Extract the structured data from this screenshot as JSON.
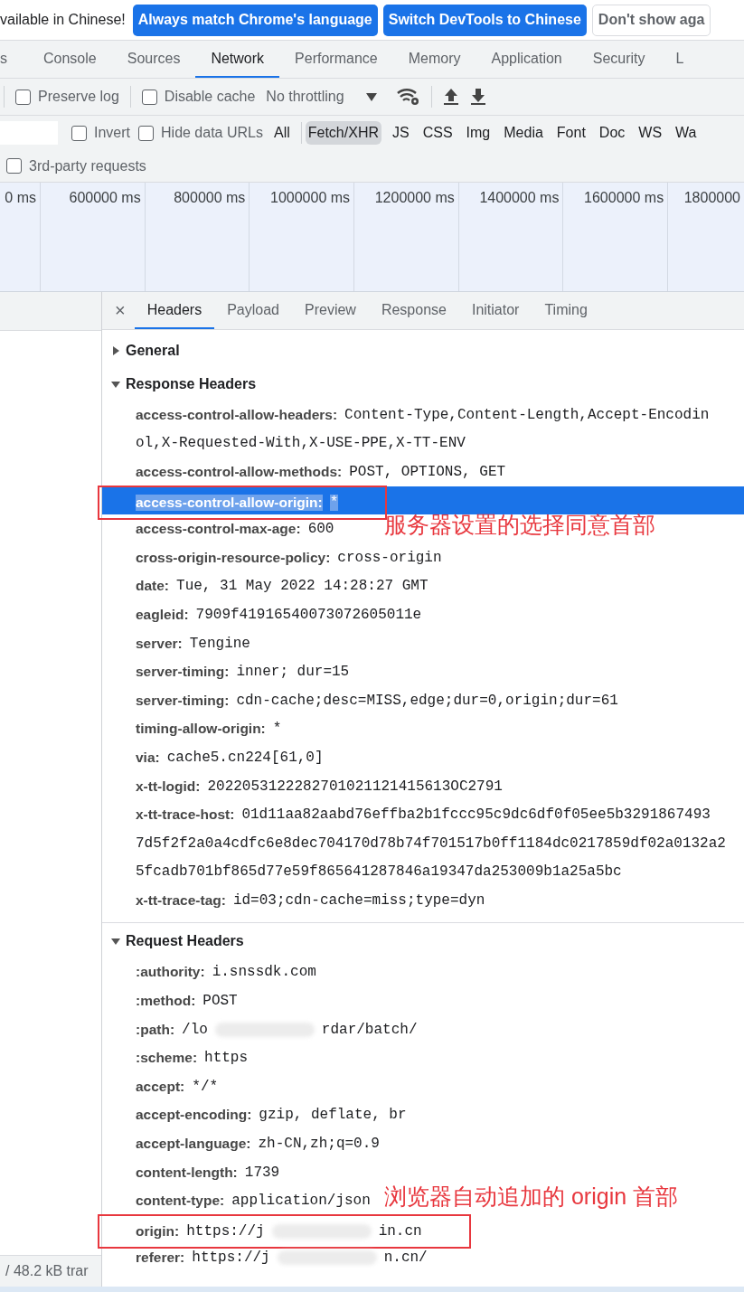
{
  "infobar": {
    "message": "vailable in Chinese!",
    "buttons": [
      {
        "label": "Always match Chrome's language",
        "kind": "primary"
      },
      {
        "label": "Switch DevTools to Chinese",
        "kind": "primary"
      },
      {
        "label": "Don't show aga",
        "kind": "secondary"
      }
    ]
  },
  "main_tabs": [
    {
      "label": "s",
      "selected": false
    },
    {
      "label": "Console",
      "selected": false
    },
    {
      "label": "Sources",
      "selected": false
    },
    {
      "label": "Network",
      "selected": true
    },
    {
      "label": "Performance",
      "selected": false
    },
    {
      "label": "Memory",
      "selected": false
    },
    {
      "label": "Application",
      "selected": false
    },
    {
      "label": "Security",
      "selected": false
    },
    {
      "label": "L",
      "selected": false
    }
  ],
  "toolbar": {
    "preserve_log": {
      "label": "Preserve log",
      "checked": false
    },
    "disable_cache": {
      "label": "Disable cache",
      "checked": false
    },
    "throttling": "No throttling"
  },
  "filter_bar": {
    "invert": {
      "label": "Invert",
      "checked": false
    },
    "hide_data_urls": {
      "label": "Hide data URLs",
      "checked": false
    },
    "types": [
      {
        "label": "All",
        "selected": false
      },
      {
        "label": "Fetch/XHR",
        "selected": true
      },
      {
        "label": "JS",
        "selected": false
      },
      {
        "label": "CSS",
        "selected": false
      },
      {
        "label": "Img",
        "selected": false
      },
      {
        "label": "Media",
        "selected": false
      },
      {
        "label": "Font",
        "selected": false
      },
      {
        "label": "Doc",
        "selected": false
      },
      {
        "label": "WS",
        "selected": false
      },
      {
        "label": "Wa",
        "selected": false
      }
    ]
  },
  "third_party": {
    "label": "3rd-party requests",
    "checked": false
  },
  "timeline_ticks": [
    "0 ms",
    "600000 ms",
    "800000 ms",
    "1000000 ms",
    "1200000 ms",
    "1400000 ms",
    "1600000 ms",
    "1800000"
  ],
  "request_list": {
    "status": "/ 48.2 kB trar"
  },
  "detail_tabs": {
    "close": "×",
    "tabs": [
      {
        "label": "Headers",
        "selected": true
      },
      {
        "label": "Payload",
        "selected": false
      },
      {
        "label": "Preview",
        "selected": false
      },
      {
        "label": "Response",
        "selected": false
      },
      {
        "label": "Initiator",
        "selected": false
      },
      {
        "label": "Timing",
        "selected": false
      }
    ]
  },
  "sections": [
    {
      "title": "General",
      "expanded": false
    },
    {
      "title": "Response Headers",
      "expanded": true,
      "headers": [
        {
          "name": "access-control-allow-headers:",
          "kind": "plain",
          "value_lines": [
            "Content-Type,Content-Length,Accept-Encodin",
            "ol,X-Requested-With,X-USE-PPE,X-TT-ENV"
          ],
          "selected": false,
          "boxed": false
        },
        {
          "name": "access-control-allow-methods:",
          "kind": "plain",
          "value_lines": [
            "POST, OPTIONS, GET"
          ],
          "selected": false,
          "boxed": false
        },
        {
          "name": "access-control-allow-origin:",
          "kind": "plain",
          "value_lines": [
            "*"
          ],
          "selected": true,
          "boxed": true
        },
        {
          "name": "access-control-max-age:",
          "kind": "plain",
          "value_lines": [
            "600"
          ],
          "selected": false,
          "boxed": false,
          "note": "服务器设置的选择同意首部"
        },
        {
          "name": "cross-origin-resource-policy:",
          "kind": "plain",
          "value_lines": [
            "cross-origin"
          ],
          "selected": false,
          "boxed": false
        },
        {
          "name": "date:",
          "kind": "plain",
          "value_lines": [
            "Tue, 31 May 2022 14:28:27 GMT"
          ],
          "selected": false,
          "boxed": false
        },
        {
          "name": "eagleid:",
          "kind": "plain",
          "value_lines": [
            "7909f41916540073072605011e"
          ],
          "selected": false,
          "boxed": false
        },
        {
          "name": "server:",
          "kind": "plain",
          "value_lines": [
            "Tengine"
          ],
          "selected": false,
          "boxed": false
        },
        {
          "name": "server-timing:",
          "kind": "plain",
          "value_lines": [
            "inner; dur=15"
          ],
          "selected": false,
          "boxed": false
        },
        {
          "name": "server-timing:",
          "kind": "plain",
          "value_lines": [
            "cdn-cache;desc=MISS,edge;dur=0,origin;dur=61"
          ],
          "selected": false,
          "boxed": false
        },
        {
          "name": "timing-allow-origin:",
          "kind": "plain",
          "value_lines": [
            "*"
          ],
          "selected": false,
          "boxed": false
        },
        {
          "name": "via:",
          "kind": "plain",
          "value_lines": [
            "cache5.cn224[61,0]"
          ],
          "selected": false,
          "boxed": false
        },
        {
          "name": "x-tt-logid:",
          "kind": "plain",
          "value_lines": [
            "2022053122282701021121415613OC2791"
          ],
          "selected": false,
          "boxed": false
        },
        {
          "name": "x-tt-trace-host:",
          "kind": "plain",
          "value_lines": [
            "01d11aa82aabd76effba2b1fccc95c9dc6df0f05ee5b3291867493",
            "7d5f2f2a0a4cdfc6e8dec704170d78b74f701517b0ff1184dc0217859df02a0132a2",
            "5fcadb701bf865d77e59f865641287846a19347da253009b1a25a5bc"
          ],
          "selected": false,
          "boxed": false
        },
        {
          "name": "x-tt-trace-tag:",
          "kind": "plain",
          "value_lines": [
            "id=03;cdn-cache=miss;type=dyn"
          ],
          "selected": false,
          "boxed": false
        }
      ]
    },
    {
      "title": "Request Headers",
      "expanded": true,
      "headers": [
        {
          "name": ":authority:",
          "kind": "plain",
          "value_lines": [
            "i.snssdk.com"
          ],
          "selected": false,
          "boxed": false
        },
        {
          "name": ":method:",
          "kind": "plain",
          "value_lines": [
            "POST"
          ],
          "selected": false,
          "boxed": false
        },
        {
          "name": ":path:",
          "kind": "redacted",
          "value_parts": [
            "/lo",
            "rdar/batch/"
          ],
          "selected": false,
          "boxed": false
        },
        {
          "name": ":scheme:",
          "kind": "plain",
          "value_lines": [
            "https"
          ],
          "selected": false,
          "boxed": false
        },
        {
          "name": "accept:",
          "kind": "plain",
          "value_lines": [
            "*/*"
          ],
          "selected": false,
          "boxed": false
        },
        {
          "name": "accept-encoding:",
          "kind": "plain",
          "value_lines": [
            "gzip, deflate, br"
          ],
          "selected": false,
          "boxed": false
        },
        {
          "name": "accept-language:",
          "kind": "plain",
          "value_lines": [
            "zh-CN,zh;q=0.9"
          ],
          "selected": false,
          "boxed": false
        },
        {
          "name": "content-length:",
          "kind": "plain",
          "value_lines": [
            "1739"
          ],
          "selected": false,
          "boxed": false
        },
        {
          "name": "content-type:",
          "kind": "plain",
          "value_lines": [
            "application/json"
          ],
          "selected": false,
          "boxed": false,
          "note": "浏览器自动追加的 origin 首部"
        },
        {
          "name": "origin:",
          "kind": "redacted",
          "value_parts": [
            "https://j",
            "in.cn"
          ],
          "selected": false,
          "boxed": true
        },
        {
          "name": "referer:",
          "kind": "redacted",
          "value_parts": [
            "https://j",
            "n.cn/"
          ],
          "selected": false,
          "boxed": false
        }
      ]
    }
  ]
}
